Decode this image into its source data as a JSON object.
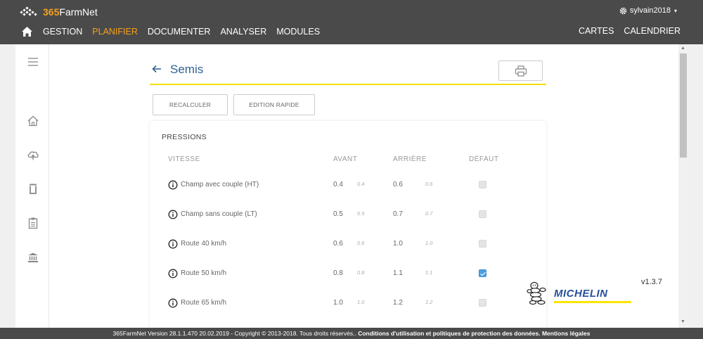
{
  "header": {
    "logo_prefix": "365",
    "logo_suffix": "FarmNet",
    "user_name": "sylvain2018",
    "caret": "▾",
    "nav_left": [
      {
        "label": "GESTION",
        "active": false
      },
      {
        "label": "PLANIFIER",
        "active": true
      },
      {
        "label": "DOCUMENTER",
        "active": false
      },
      {
        "label": "ANALYSER",
        "active": false
      },
      {
        "label": "MODULES",
        "active": false
      }
    ],
    "nav_right": [
      {
        "label": "CARTES"
      },
      {
        "label": "CALENDRIER"
      }
    ],
    "accent_color": "#f6a21e",
    "bar_color": "#4a4a4a"
  },
  "sidebar": {
    "icons": [
      "menu-icon",
      "home-icon",
      "cloud-upload-icon",
      "trash-icon",
      "clipboard-icon",
      "bank-icon"
    ]
  },
  "page": {
    "title": "Semis",
    "title_color": "#2f5f94",
    "underline_color": "#f2e000",
    "buttons": {
      "recalc": "RECALCULER",
      "edit": "EDITION RAPIDE"
    }
  },
  "pressures": {
    "title": "PRESSIONS",
    "headers": {
      "speed": "VITESSE",
      "front": "AVANT",
      "rear": "ARRIÈRE",
      "default": "DÉFAUT"
    },
    "rows": [
      {
        "label": "Champ avec couple (HT)",
        "front": "0.4",
        "front_sub": "0.4",
        "rear": "0.6",
        "rear_sub": "0.6",
        "default": false
      },
      {
        "label": "Champ sans couple (LT)",
        "front": "0.5",
        "front_sub": "0.5",
        "rear": "0.7",
        "rear_sub": "0.7",
        "default": false
      },
      {
        "label": "Route 40 km/h",
        "front": "0.6",
        "front_sub": "0.6",
        "rear": "1.0",
        "rear_sub": "1.0",
        "default": false
      },
      {
        "label": "Route 50 km/h",
        "front": "0.8",
        "front_sub": "0.8",
        "rear": "1.1",
        "rear_sub": "1.1",
        "default": true
      },
      {
        "label": "Route 65 km/h",
        "front": "1.0",
        "front_sub": "1.0",
        "rear": "1.2",
        "rear_sub": "1.2",
        "default": false
      }
    ]
  },
  "brand": {
    "name": "MICHELIN",
    "version": "v1.3.7",
    "color": "#27509b",
    "bar_color": "#fce500"
  },
  "footer": {
    "text": "365FarmNet Version 28.1.1.470 20.02.2019 - Copyright © 2013-2018. Tous droits réservés.. ",
    "link": "Conditions d'utilisation et politiques de protection des données. Mentions légales"
  },
  "scrollbar": {
    "up": "▲",
    "down": "▼"
  }
}
